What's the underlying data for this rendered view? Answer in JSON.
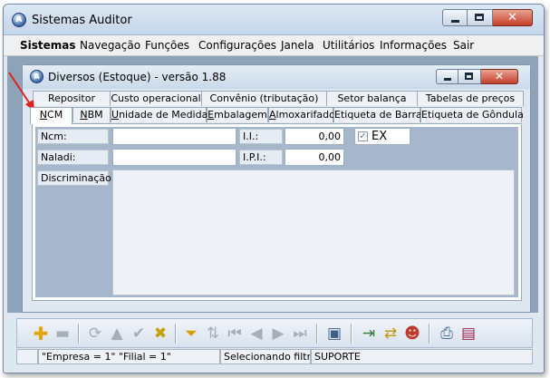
{
  "app": {
    "title": "Sistemas Auditor",
    "icon_letter": "A"
  },
  "menu": [
    "Sistemas",
    "Navegação",
    "Funções",
    "Configurações",
    "Janela",
    "Utilitários",
    "Informações",
    "Sair"
  ],
  "child": {
    "title": "Diversos (Estoque) - versão 1.88",
    "icon_letter": "A"
  },
  "tabs_back": [
    "Repositor",
    "Custo operacional",
    "Convênio (tributação)",
    "Setor balança",
    "Tabelas de preços"
  ],
  "tabs_front": [
    {
      "label": "NCM",
      "ul": "N",
      "rest": "CM"
    },
    {
      "label": "NBM",
      "ul": "N",
      "rest": "BM",
      "pre": ""
    },
    {
      "label": "Unidade de Medida",
      "ul": "U",
      "rest": "nidade de Medida"
    },
    {
      "label": "Embalagem",
      "ul": "E",
      "rest": "mbalagem"
    },
    {
      "label": "Almoxarifado",
      "ul": "A",
      "rest": "lmoxarifado"
    },
    {
      "label": "Etiqueta de Barra",
      "ul": "",
      "rest": "Etiqueta de Barra"
    },
    {
      "label": "Etiqueta de Gôndula",
      "ul": "",
      "rest": "Etiqueta de Gôndula"
    }
  ],
  "active_tab": "NCM",
  "form": {
    "ncm_label": "Ncm:",
    "ncm_value": "",
    "naladi_label": "Naladi:",
    "naladi_value": "",
    "ii_label": "I.I.:",
    "ii_value": "0,00",
    "ipi_label": "I.P.I.:",
    "ipi_value": "0,00",
    "ex_label": "EX",
    "ex_checked": true,
    "discriminacao_label": "Discriminação:",
    "discriminacao_value": ""
  },
  "status": [
    "\"Empresa = 1\"   \"Filial = 1\"",
    "Selecionando filtro",
    "SUPORTE"
  ],
  "icons": {
    "add": "plus-icon",
    "remove": "minus-icon",
    "refresh": "refresh-icon",
    "up": "up-icon",
    "confirm": "check-icon",
    "cancel": "x-icon",
    "filter": "filter-icon",
    "sort": "sort-icon",
    "first": "first-icon",
    "prev": "prev-icon",
    "next": "next-icon",
    "last": "last-icon",
    "save": "save-icon",
    "import": "import-icon",
    "export": "export-icon",
    "users": "users-icon",
    "print": "print-icon",
    "report": "report-icon"
  },
  "colors": {
    "accent_red": "#e02020",
    "mdi_bg": "#8ea2b8",
    "panel_inner": "#a6b6cb"
  }
}
